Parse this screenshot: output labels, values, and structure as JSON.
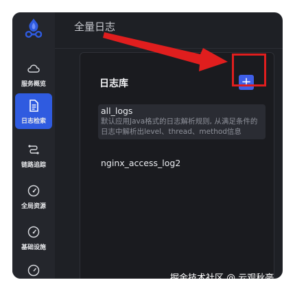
{
  "header": {
    "title": "全量日志"
  },
  "sidebar": {
    "items": [
      {
        "label": "服务概览",
        "icon": "cloud-icon",
        "active": false
      },
      {
        "label": "日志检索",
        "icon": "document-icon",
        "active": true
      },
      {
        "label": "链路追踪",
        "icon": "route-icon",
        "active": false
      },
      {
        "label": "全局资源",
        "icon": "gauge-icon",
        "active": false
      },
      {
        "label": "基础设施",
        "icon": "gauge-icon",
        "active": false
      }
    ]
  },
  "panel": {
    "title": "日志库",
    "add_label": "+",
    "logs": [
      {
        "name": "all_logs",
        "description": "默认应用Java格式的日志解析规则, 从满足条件的日志中解析出level、thread、method信息"
      },
      {
        "name": "nginx_access_log2",
        "description": ""
      }
    ]
  },
  "watermark": "掘金技术社区 @ 云观秋毫",
  "colors": {
    "accent": "#2f5be0",
    "annotation": "#e01e1e",
    "background": "#1e2025"
  }
}
